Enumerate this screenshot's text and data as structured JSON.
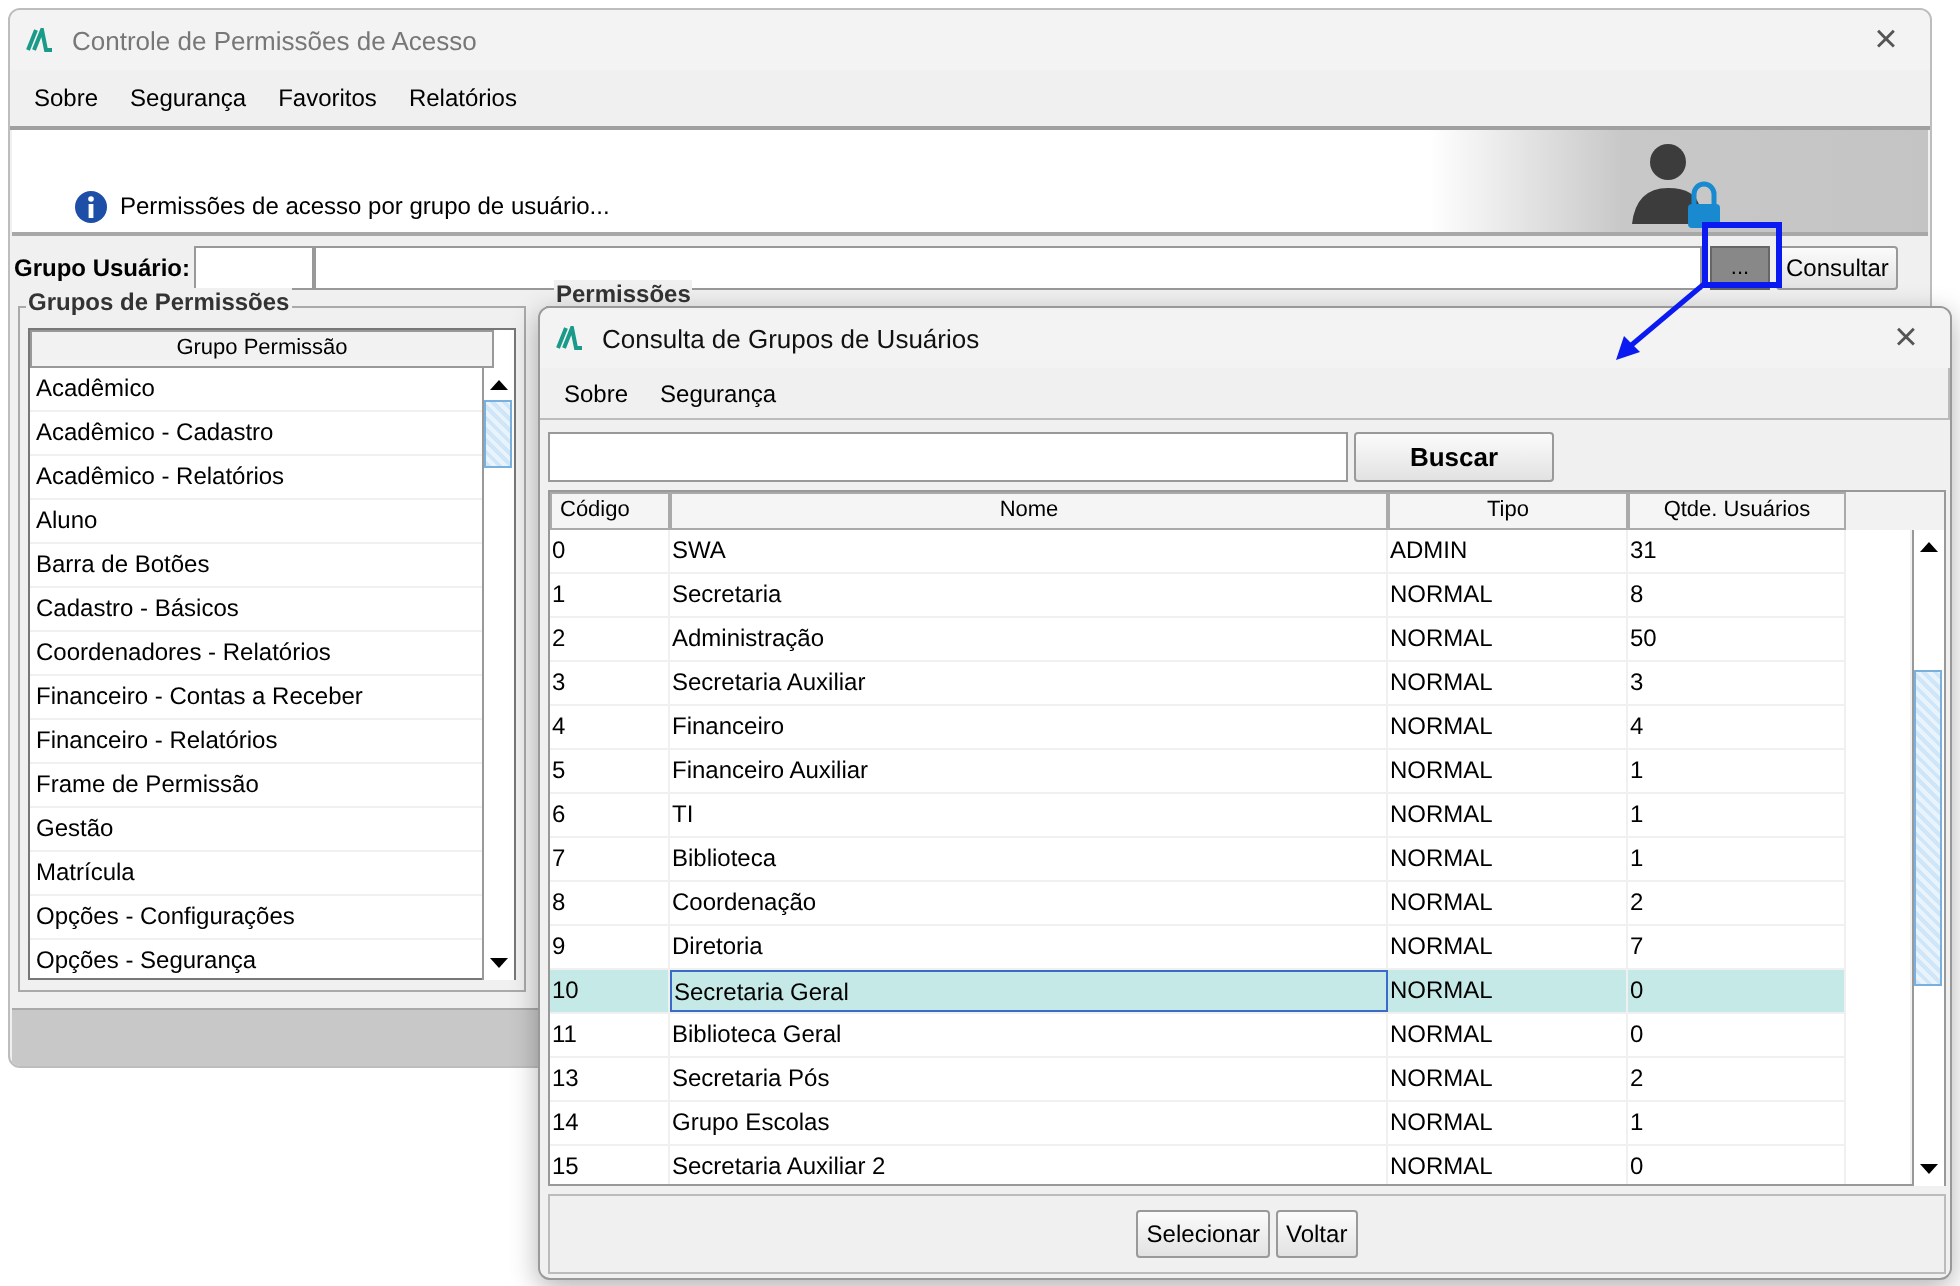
{
  "window": {
    "title": "Controle de Permissões de Acesso",
    "close": "×"
  },
  "menu": [
    "Sobre",
    "Segurança",
    "Favoritos",
    "Relatórios"
  ],
  "banner": {
    "text": "Permissões de acesso por grupo de usuário..."
  },
  "user_group": {
    "label": "Grupo Usuário:",
    "browse_button": "...",
    "query_button": "Consultar"
  },
  "permission_groups": {
    "title": "Grupos de Permissões",
    "column": "Grupo Permissão",
    "items": [
      "Acadêmico",
      "Acadêmico - Cadastro",
      "Acadêmico - Relatórios",
      "Aluno",
      "Barra de Botões",
      "Cadastro - Básicos",
      "Coordenadores - Relatórios",
      "Financeiro - Contas a Receber",
      "Financeiro - Relatórios",
      "Frame de Permissão",
      "Gestão",
      "Matrícula",
      "Opções - Configurações",
      "Opções - Segurança"
    ]
  },
  "permissions": {
    "title": "Permissões"
  },
  "dialog": {
    "title": "Consulta de Grupos de Usuários",
    "close": "×",
    "menu": [
      "Sobre",
      "Segurança"
    ],
    "search_button": "Buscar",
    "columns": [
      "Código",
      "Nome",
      "Tipo",
      "Qtde. Usuários"
    ],
    "rows": [
      {
        "code": "0",
        "name": "SWA",
        "type": "ADMIN",
        "users": "31",
        "selected": false
      },
      {
        "code": "1",
        "name": "Secretaria",
        "type": "NORMAL",
        "users": "8",
        "selected": false
      },
      {
        "code": "2",
        "name": "Administração",
        "type": "NORMAL",
        "users": "50",
        "selected": false
      },
      {
        "code": "3",
        "name": "Secretaria Auxiliar",
        "type": "NORMAL",
        "users": "3",
        "selected": false
      },
      {
        "code": "4",
        "name": "Financeiro",
        "type": "NORMAL",
        "users": "4",
        "selected": false
      },
      {
        "code": "5",
        "name": "Financeiro Auxiliar",
        "type": "NORMAL",
        "users": "1",
        "selected": false
      },
      {
        "code": "6",
        "name": "TI",
        "type": "NORMAL",
        "users": "1",
        "selected": false
      },
      {
        "code": "7",
        "name": "Biblioteca",
        "type": "NORMAL",
        "users": "1",
        "selected": false
      },
      {
        "code": "8",
        "name": "Coordenação",
        "type": "NORMAL",
        "users": "2",
        "selected": false
      },
      {
        "code": "9",
        "name": "Diretoria",
        "type": "NORMAL",
        "users": "7",
        "selected": false
      },
      {
        "code": "10",
        "name": "Secretaria Geral",
        "type": "NORMAL",
        "users": "0",
        "selected": true
      },
      {
        "code": "11",
        "name": "Biblioteca Geral",
        "type": "NORMAL",
        "users": "0",
        "selected": false
      },
      {
        "code": "13",
        "name": "Secretaria Pós",
        "type": "NORMAL",
        "users": "2",
        "selected": false
      },
      {
        "code": "14",
        "name": "Grupo Escolas",
        "type": "NORMAL",
        "users": "1",
        "selected": false
      },
      {
        "code": "15",
        "name": "Secretaria Auxiliar 2",
        "type": "NORMAL",
        "users": "0",
        "selected": false
      }
    ],
    "buttons": [
      "Selecionar",
      "Voltar"
    ]
  }
}
